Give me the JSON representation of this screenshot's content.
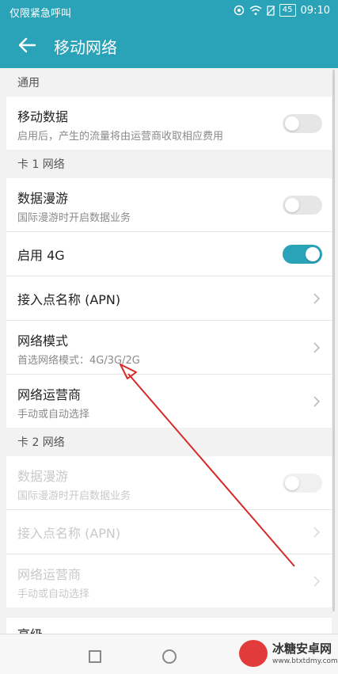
{
  "status_bar": {
    "left_text": "仅限紧急呼叫",
    "battery": "45",
    "time": "09:10"
  },
  "app_bar": {
    "title": "移动网络"
  },
  "sections": {
    "general": {
      "header": "通用",
      "mobile_data": {
        "title": "移动数据",
        "subtitle": "启用后，产生的流量将由运营商收取相应费用",
        "enabled": false
      }
    },
    "sim1": {
      "header": "卡 1 网络",
      "roaming": {
        "title": "数据漫游",
        "subtitle": "国际漫游时开启数据业务",
        "enabled": false
      },
      "enable4g": {
        "title": "启用 4G",
        "enabled": true
      },
      "apn": {
        "title": "接入点名称 (APN)"
      },
      "network_mode": {
        "title": "网络模式",
        "subtitle": "首选网络模式：4G/3G/2G"
      },
      "operator": {
        "title": "网络运营商",
        "subtitle": "手动或自动选择"
      }
    },
    "sim2": {
      "header": "卡 2 网络",
      "roaming": {
        "title": "数据漫游",
        "subtitle": "国际漫游时开启数据业务",
        "enabled": false
      },
      "apn": {
        "title": "接入点名称 (APN)"
      },
      "operator": {
        "title": "网络运营商",
        "subtitle": "手动或自动选择"
      }
    },
    "advanced": {
      "title": "高级"
    }
  },
  "watermark": {
    "name": "冰糖安卓网",
    "url": "www.btxtdmy.com"
  },
  "colors": {
    "accent": "#2aa3b8",
    "annotation_arrow": "#d62a2a"
  }
}
